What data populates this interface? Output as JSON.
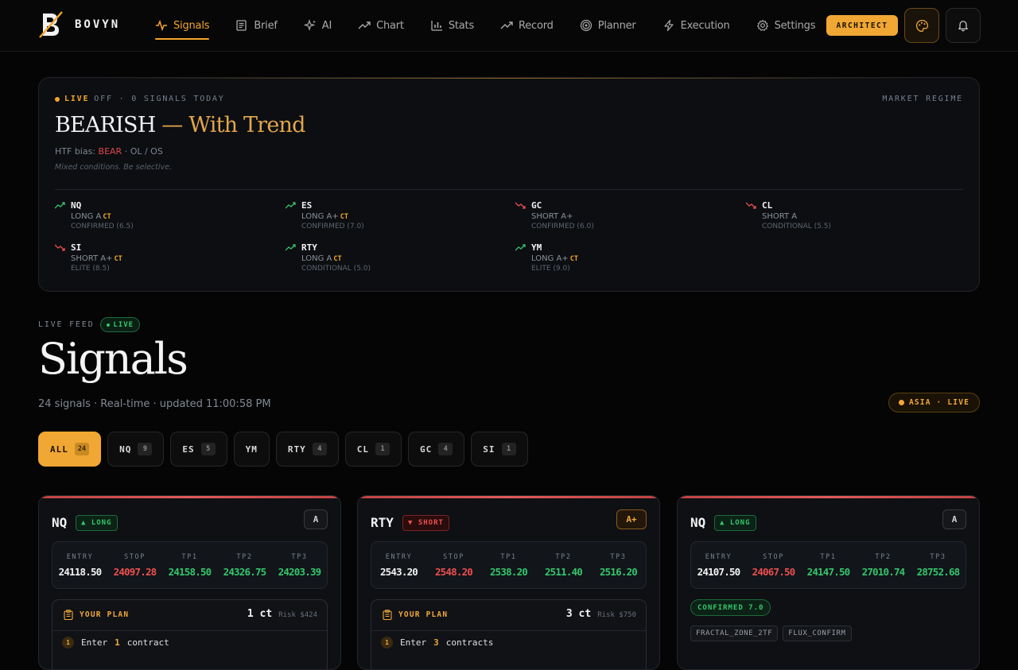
{
  "app": {
    "brand": "BOVYN"
  },
  "nav": [
    {
      "label": "Signals",
      "icon": "pulse-icon",
      "active": true
    },
    {
      "label": "Brief",
      "icon": "newspaper-icon"
    },
    {
      "label": "AI",
      "icon": "sparkles-icon"
    },
    {
      "label": "Chart",
      "icon": "trend-icon"
    },
    {
      "label": "Stats",
      "icon": "bar-chart-icon"
    },
    {
      "label": "Record",
      "icon": "trend-icon"
    },
    {
      "label": "Planner",
      "icon": "target-icon"
    },
    {
      "label": "Execution",
      "icon": "bolt-icon"
    },
    {
      "label": "Settings",
      "icon": "gear-icon"
    }
  ],
  "header": {
    "architect_label": "ARCHITECT"
  },
  "regime": {
    "live_label": "LIVE",
    "live_status": "OFF · 0 SIGNALS TODAY",
    "market_regime_label": "MARKET REGIME",
    "title_main": "BEARISH",
    "title_trend": "— With Trend",
    "bias_prefix": "HTF bias:",
    "bias_value": "BEAR",
    "bias_suffix": "· OL / OS",
    "note": "Mixed conditions. Be selective.",
    "instruments": [
      {
        "symbol": "NQ",
        "direction": "LONG A",
        "ct": "CT",
        "status": "CONFIRMED (6.5)",
        "trend": "up"
      },
      {
        "symbol": "ES",
        "direction": "LONG A+",
        "ct": "CT",
        "status": "CONFIRMED (7.0)",
        "trend": "up"
      },
      {
        "symbol": "GC",
        "direction": "SHORT A+",
        "ct": "",
        "status": "CONFIRMED (6.0)",
        "trend": "down"
      },
      {
        "symbol": "CL",
        "direction": "SHORT A",
        "ct": "",
        "status": "CONDITIONAL (5.5)",
        "trend": "down"
      },
      {
        "symbol": "SI",
        "direction": "SHORT A+",
        "ct": "CT",
        "status": "ELITE (8.5)",
        "trend": "down"
      },
      {
        "symbol": "RTY",
        "direction": "LONG A",
        "ct": "CT",
        "status": "CONDITIONAL (5.0)",
        "trend": "up"
      },
      {
        "symbol": "YM",
        "direction": "LONG A+",
        "ct": "CT",
        "status": "ELITE (9.0)",
        "trend": "up"
      }
    ]
  },
  "feed": {
    "label": "LIVE FEED",
    "live_badge": "LIVE",
    "title": "Signals",
    "subtitle": "24 signals · Real-time · updated 11:00:58 PM",
    "session_badge": "ASIA · LIVE"
  },
  "filters": [
    {
      "label": "ALL",
      "count": "24",
      "active": true
    },
    {
      "label": "NQ",
      "count": "9"
    },
    {
      "label": "ES",
      "count": "5"
    },
    {
      "label": "YM",
      "count": ""
    },
    {
      "label": "RTY",
      "count": "4"
    },
    {
      "label": "CL",
      "count": "1"
    },
    {
      "label": "GC",
      "count": "4"
    },
    {
      "label": "SI",
      "count": "1"
    }
  ],
  "level_headers": [
    "ENTRY",
    "STOP",
    "TP1",
    "TP2",
    "TP3"
  ],
  "cards": [
    {
      "symbol": "NQ",
      "direction": "LONG",
      "direction_arrow": "▲",
      "grade": "A",
      "levels": [
        "24118.50",
        "24097.28",
        "24158.50",
        "24326.75",
        "24203.39"
      ],
      "plan": {
        "label": "YOUR PLAN",
        "contracts": "1 ct",
        "risk": "Risk $424",
        "step_num": "1",
        "step_prefix": "Enter",
        "step_value": "1",
        "step_suffix": "contract"
      }
    },
    {
      "symbol": "RTY",
      "direction": "SHORT",
      "direction_arrow": "▼",
      "grade": "A+",
      "levels": [
        "2543.20",
        "2548.20",
        "2538.20",
        "2511.40",
        "2516.20"
      ],
      "plan": {
        "label": "YOUR PLAN",
        "contracts": "3 ct",
        "risk": "Risk $750",
        "step_num": "1",
        "step_prefix": "Enter",
        "step_value": "3",
        "step_suffix": "contracts"
      }
    },
    {
      "symbol": "NQ",
      "direction": "LONG",
      "direction_arrow": "▲",
      "grade": "A",
      "levels": [
        "24107.50",
        "24067.50",
        "24147.50",
        "27010.74",
        "28752.68"
      ],
      "confirmation": "CONFIRMED 7.0",
      "tags": [
        "FRACTAL_ZONE_2TF",
        "FLUX_CONFIRM"
      ]
    }
  ],
  "colors": {
    "accent": "#f1a733",
    "green": "#35c56c",
    "red": "#ec4f4f"
  }
}
